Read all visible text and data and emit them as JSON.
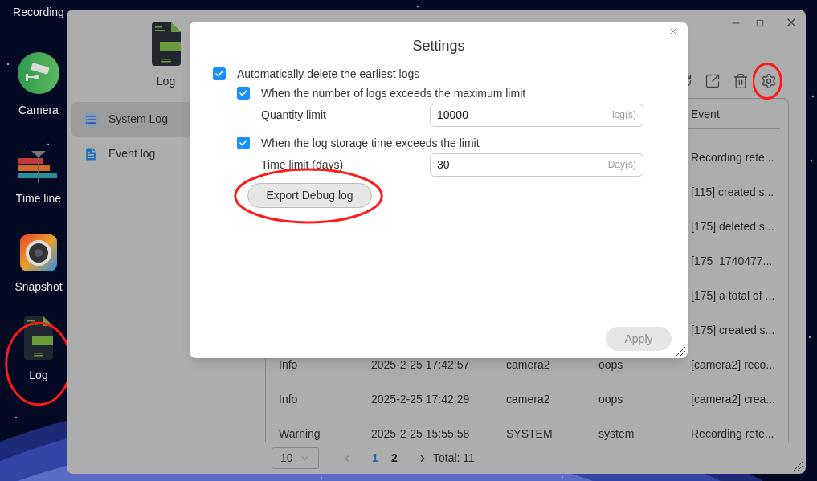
{
  "desktop": {
    "icons": [
      {
        "kind": "text",
        "label": "Recording",
        "circled": false
      },
      {
        "kind": "camera",
        "label": "Camera",
        "circled": false
      },
      {
        "kind": "timeline",
        "label": "Time line",
        "circled": false
      },
      {
        "kind": "snapshot",
        "label": "Snapshot",
        "circled": false
      },
      {
        "kind": "log",
        "label": "Log",
        "circled": true
      }
    ]
  },
  "window": {
    "app_title": "Log",
    "nav": [
      {
        "kind": "list",
        "label": "System Log",
        "selected": true
      },
      {
        "kind": "doc",
        "label": "Event log",
        "selected": false
      }
    ],
    "toolbar": [
      {
        "kind": "refresh",
        "circled": false
      },
      {
        "kind": "export",
        "circled": false
      },
      {
        "kind": "delete",
        "circled": false
      },
      {
        "kind": "settings",
        "circled": true
      }
    ],
    "table": {
      "columns": [
        "Event"
      ],
      "rows": [
        {
          "event": "Recording rete..."
        },
        {
          "event": "[115] created s..."
        },
        {
          "event": "[175] deleted s..."
        },
        {
          "event": "[175_1740477..."
        },
        {
          "event": "[175] a total of ..."
        },
        {
          "event": "[175] created s..."
        },
        {
          "level": "Info",
          "time": "2025-2-25 17:42:57",
          "source": "camera2",
          "user": "oops",
          "event": "[camera2] reco..."
        },
        {
          "level": "Info",
          "time": "2025-2-25 17:42:29",
          "source": "camera2",
          "user": "oops",
          "event": "[camera2] crea..."
        },
        {
          "level": "Warning",
          "time": "2025-2-25 15:55:58",
          "source": "SYSTEM",
          "user": "system",
          "event": "Recording rete..."
        }
      ]
    },
    "pagination": {
      "page_size": "10",
      "prev_disabled": true,
      "pages": [
        {
          "label": "1",
          "selected": true
        },
        {
          "label": "2",
          "selected": false
        }
      ],
      "total": "Total: 11"
    }
  },
  "dialog": {
    "title": "Settings",
    "options": [
      {
        "label": "Automatically delete the earliest logs",
        "checked": true,
        "children": [
          {
            "label": "When the number of logs exceeds the maximum limit",
            "checked": true,
            "field": {
              "label": "Quantity limit",
              "value": "10000",
              "unit": "log(s)"
            }
          },
          {
            "label": "When the log storage time exceeds the limit",
            "checked": true,
            "field": {
              "label": "Time limit (days)",
              "value": "30",
              "unit": "Day(s)"
            }
          }
        ]
      }
    ],
    "export_button": {
      "label": "Export Debug log",
      "circled": true
    },
    "apply_button": {
      "label": "Apply",
      "disabled": true
    }
  }
}
